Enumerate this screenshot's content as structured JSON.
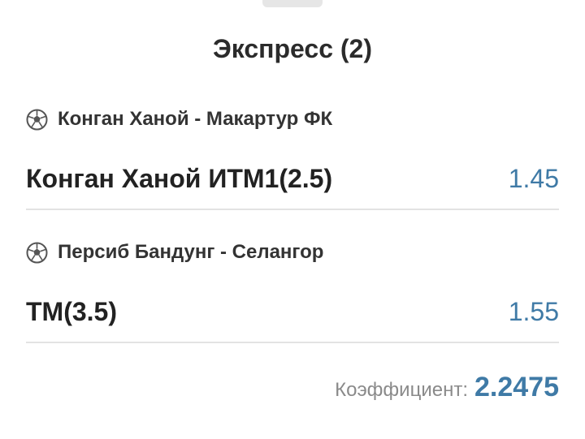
{
  "sheet": {
    "title": "Экспресс (2)"
  },
  "bets": [
    {
      "sport_icon": "soccer-ball-icon",
      "event": "Конган Ханой - Макартур ФК",
      "selection": "Конган Ханой ИТМ1(2.5)",
      "odds": "1.45"
    },
    {
      "sport_icon": "soccer-ball-icon",
      "event": "Персиб Бандунг - Селангор",
      "selection": "ТМ(3.5)",
      "odds": "1.55"
    }
  ],
  "total": {
    "label": "Коэффициент:",
    "value": "2.2475"
  },
  "colors": {
    "odds": "#3f7aa6",
    "text": "#2b2b2b",
    "divider": "#e3e3e3"
  }
}
